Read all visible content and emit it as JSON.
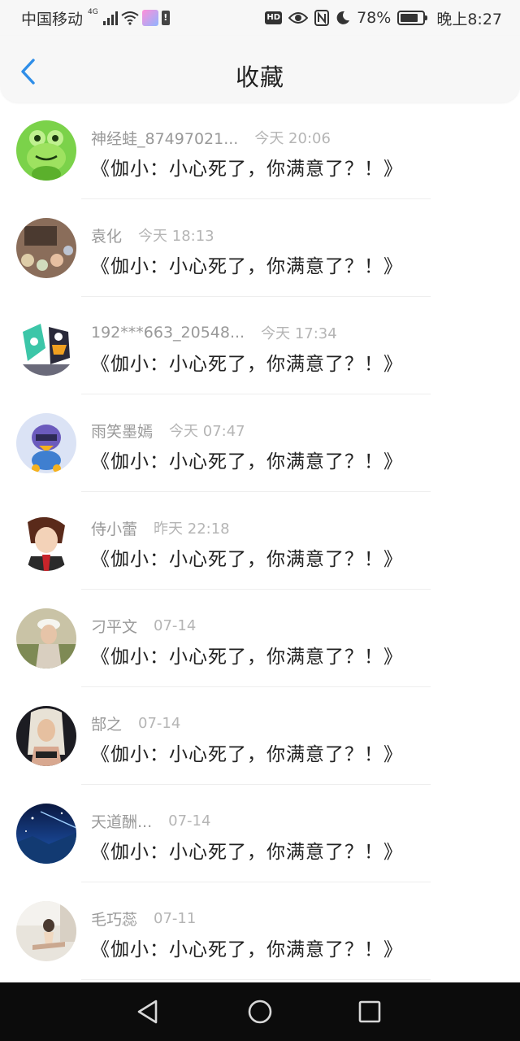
{
  "status_bar": {
    "carrier": "中国移动",
    "network": "4G",
    "battery_percent": "78%",
    "battery_level": 0.78,
    "time": "晚上8:27",
    "hd_badge": "HD",
    "icons": [
      "signal-icon",
      "wifi-icon",
      "app-notification-icon",
      "battery-alert-icon",
      "hd-icon",
      "eye-icon",
      "nfc-icon",
      "moon-icon",
      "battery-icon"
    ]
  },
  "header": {
    "title": "收藏",
    "back_icon": "chevron-left-icon",
    "accent_color": "#2f8ee8"
  },
  "favorites": [
    {
      "name": "神经蛙_87497021...",
      "time": "今天 20:06",
      "message": "《伽小：小心死了，你满意了？！》",
      "avatar": "frog-cartoon"
    },
    {
      "name": "袁化",
      "time": "今天 18:13",
      "message": "《伽小：小心死了，你满意了？！》",
      "avatar": "bokeh-photo"
    },
    {
      "name": "192***663_20548...",
      "time": "今天 17:34",
      "message": "《伽小：小心死了，你满意了？！》",
      "avatar": "cartoon-duo"
    },
    {
      "name": "雨笑墨嫣",
      "time": "今天 07:47",
      "message": "《伽小：小心死了，你满意了？！》",
      "avatar": "duck-cartoon"
    },
    {
      "name": "侍小蕾",
      "time": "昨天 22:18",
      "message": "《伽小：小心死了，你满意了？！》",
      "avatar": "anime-character"
    },
    {
      "name": "刁平文",
      "time": "07-14",
      "message": "《伽小：小心死了，你满意了？！》",
      "avatar": "person-photo"
    },
    {
      "name": "郜之",
      "time": "07-14",
      "message": "《伽小：小心死了，你满意了？！》",
      "avatar": "portrait-photo"
    },
    {
      "name": "天道酬...",
      "time": "07-14",
      "message": "《伽小：小心死了，你满意了？！》",
      "avatar": "night-sky-photo"
    },
    {
      "name": "毛巧蕊",
      "time": "07-11",
      "message": "《伽小：小心死了，你满意了？！》",
      "avatar": "beach-photo"
    }
  ],
  "nav_bar": {
    "buttons": [
      "back-triangle-icon",
      "home-circle-icon",
      "recents-square-icon"
    ]
  }
}
